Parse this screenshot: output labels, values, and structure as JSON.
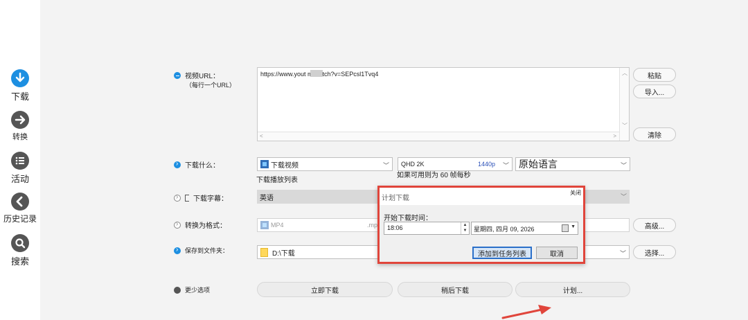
{
  "sidebar": {
    "items": [
      {
        "label": "下载",
        "icon": "download-icon",
        "active": true
      },
      {
        "label": "转换",
        "icon": "convert-arrow-icon",
        "active": false
      },
      {
        "label": "活动",
        "icon": "activity-list-icon",
        "active": false
      },
      {
        "label": "历史记录",
        "icon": "history-back-icon",
        "active": false
      },
      {
        "label": "搜索",
        "icon": "search-icon",
        "active": false
      }
    ]
  },
  "url_section": {
    "label": "视频URL：",
    "sublabel": "（每行一个URL）",
    "value": "https://www.yout         m/watch?v=SEPcsl1Tvq4",
    "paste_label": "粘贴",
    "import_label": "导入...",
    "clear_label": "清除"
  },
  "what_section": {
    "label": "下载什么：",
    "type_value": "下载视频",
    "quality_value": "QHD 2K",
    "resolution": "1440p",
    "language_value": "原始语言",
    "playlist_note": "下载播放列表",
    "fps_note": "如果可用则为 60 帧每秒"
  },
  "subtitle_section": {
    "label": "下载字幕：",
    "value": "英语"
  },
  "convert_section": {
    "label": "转换为格式：",
    "value": "MP4",
    "ext": ".mp",
    "advanced_label": "高级..."
  },
  "save_section": {
    "label": "保存到文件夹：",
    "value": "D:\\下载",
    "choose_label": "选择..."
  },
  "bottom": {
    "fewer_options": "更少选项",
    "download_now": "立即下载",
    "download_later": "稍后下载",
    "schedule": "计划..."
  },
  "dialog": {
    "title": "计划下载",
    "close": "关闭",
    "start_label": "开始下载时间：",
    "time_value": "18:06",
    "date_value": "星期四,  四月  09, 2026",
    "add_label": "添加到任务列表",
    "cancel_label": "取消"
  },
  "colors": {
    "accent": "#1d8fe1",
    "highlight_border": "#e0453b",
    "arrow": "#e0453b"
  }
}
